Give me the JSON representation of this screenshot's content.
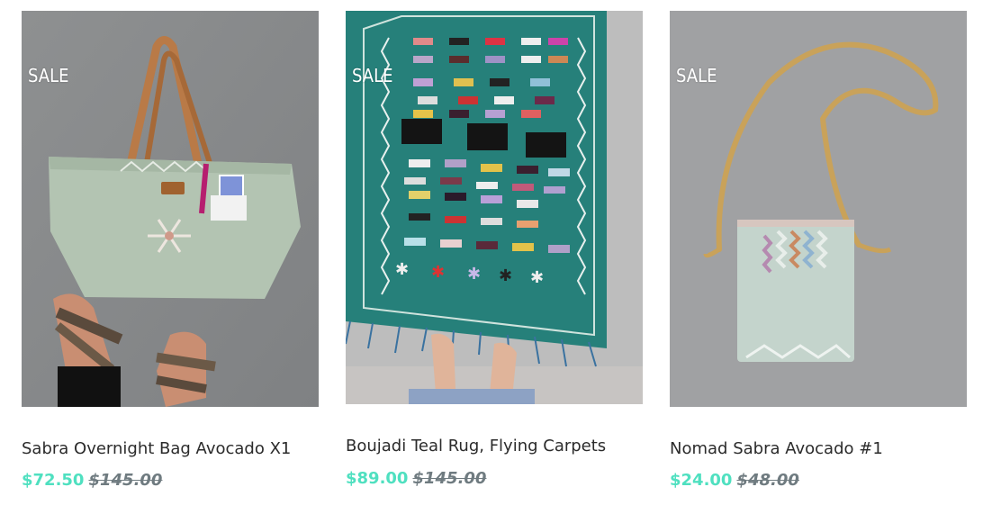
{
  "products": [
    {
      "badge": "SALE",
      "title": "Sabra Overnight Bag Avocado X1",
      "price": "$72.50",
      "old_price": "$145.00"
    },
    {
      "badge": "SALE",
      "title": "Boujadi Teal Rug, Flying Carpets",
      "price": "$89.00",
      "old_price": "$145.00"
    },
    {
      "badge": "SALE",
      "title": "Nomad Sabra Avocado #1",
      "price": "$24.00",
      "old_price": "$48.00"
    }
  ],
  "colors": {
    "sale_price": "#4fe0c0",
    "old_price": "#6f7b80",
    "title": "#2b2b2b",
    "badge": "#ffffff"
  }
}
